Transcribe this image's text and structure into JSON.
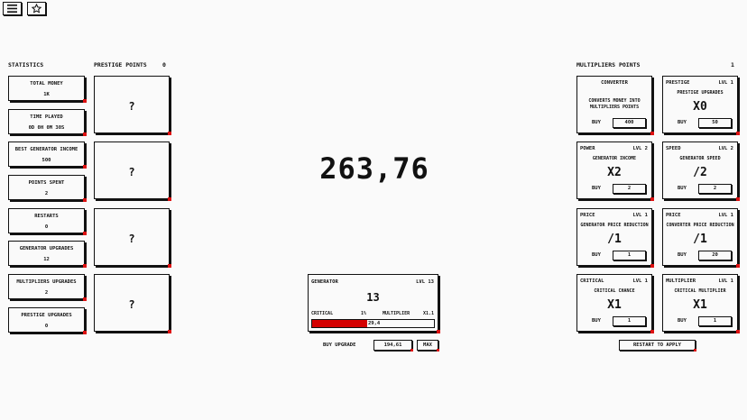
{
  "top_buttons": {
    "menu_icon": "hamburger-icon",
    "star_icon": "star-icon"
  },
  "statistics": {
    "title": "STATISTICS",
    "items": [
      {
        "label": "TOTAL MONEY",
        "value": "1K"
      },
      {
        "label": "TIME PLAYED",
        "value": "0D 0H 0M 30S"
      },
      {
        "label": "BEST GENERATOR INCOME",
        "value": "500"
      },
      {
        "label": "POINTS SPENT",
        "value": "2"
      },
      {
        "label": "RESTARTS",
        "value": "0"
      },
      {
        "label": "GENERATOR UPGRADES",
        "value": "12"
      },
      {
        "label": "MULTIPLIERS UPGRADES",
        "value": "2"
      },
      {
        "label": "PRESTIGE UPGRADES",
        "value": "0"
      }
    ]
  },
  "prestige": {
    "title": "PRESTIGE POINTS",
    "value": "0",
    "slots": [
      "?",
      "?",
      "?",
      "?"
    ]
  },
  "money": "263,76",
  "generator": {
    "title": "GENERATOR",
    "level": "LVL 13",
    "count": "13",
    "critical_label": "CRITICAL",
    "critical_value": "1%",
    "multiplier_label": "MULTIPLIER",
    "multiplier_value": "x1.1",
    "progress_text": "29,4",
    "progress_fraction": 0.45,
    "progress_color": "#d40000"
  },
  "buy_upgrade": {
    "label": "BUY UPGRADE",
    "price": "194,61",
    "max_label": "MAX"
  },
  "multipliers": {
    "title": "MULTIPLIERS POINTS",
    "value": "1",
    "cards": [
      {
        "name": "CONVERTER",
        "level": "",
        "desc": "CONVERTS MONEY INTO MULTIPLIERS POINTS",
        "mult": "",
        "buy": "BUY",
        "price": "400"
      },
      {
        "name": "PRESTIGE",
        "level": "LVL 1",
        "desc": "PRESTIGE UPGRADES",
        "mult": "x0",
        "buy": "BUY",
        "price": "50"
      },
      {
        "name": "POWER",
        "level": "LVL 2",
        "desc": "GENERATOR INCOME",
        "mult": "x2",
        "buy": "BUY",
        "price": "2"
      },
      {
        "name": "SPEED",
        "level": "LVL 2",
        "desc": "GENERATOR SPEED",
        "mult": "/2",
        "buy": "BUY",
        "price": "2"
      },
      {
        "name": "PRICE",
        "level": "LVL 1",
        "desc": "GENERATOR PRICE REDUCTION",
        "mult": "/1",
        "buy": "BUY",
        "price": "1"
      },
      {
        "name": "PRICE",
        "level": "LVL 1",
        "desc": "CONVERTER PRICE REDUCTION",
        "mult": "/1",
        "buy": "BUY",
        "price": "20"
      },
      {
        "name": "CRITICAL",
        "level": "LVL 1",
        "desc": "CRITICAL CHANCE",
        "mult": "x1",
        "buy": "BUY",
        "price": "1"
      },
      {
        "name": "MULTIPLIER",
        "level": "LVL 1",
        "desc": "CRITICAL MULTIPLIER",
        "mult": "x1",
        "buy": "BUY",
        "price": "1"
      }
    ],
    "restart_label": "RESTART TO APPLY"
  }
}
